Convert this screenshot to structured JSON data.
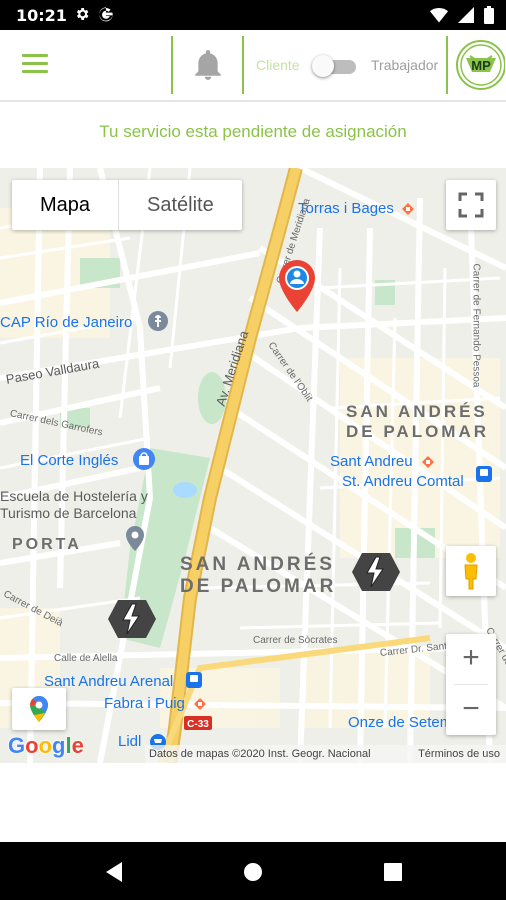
{
  "status_bar": {
    "time": "10:21"
  },
  "header": {
    "role_left": "Cliente",
    "role_right": "Trabajador",
    "logo_text": "MP"
  },
  "pending_message": "Tu servicio esta pendiente de asignación",
  "map": {
    "type_buttons": {
      "map": "Mapa",
      "satellite": "Satélite"
    },
    "zoom_in": "+",
    "zoom_out": "−",
    "google_logo": "Google",
    "attribution": "Datos de mapas ©2020 Inst. Geogr. Nacional",
    "terms": "Términos de uso",
    "labels": {
      "torras": "Torras i Bages",
      "cap": "CAP Río de Janeiro",
      "paseo": "Paseo Valldaura",
      "sa_big1": "SAN ANDRÉS",
      "sa_big1b": "DE PALOMAR",
      "sant_andreu": "Sant Andreu",
      "st_andreu_comtal": "St. Andreu Comtal",
      "corte": "El Corte Inglés",
      "escuela1": "Escuela de Hostelería y",
      "escuela2": "Turismo de Barcelona",
      "porta": "PORTA",
      "sa_big2": "SAN ANDRÉS",
      "sa_big2b": "DE PALOMAR",
      "meridiana": "Av. Meridiana",
      "carrer_meridiana": "Carrer de Meridiana",
      "carrer_garrofers": "Carrer dels Garrofers",
      "carrer_oblit": "Carrer de l'Oblit",
      "carrer_fernando": "Carrer de Fernando Pessoa",
      "carrer_socrates": "Carrer de Sòcrates",
      "carrer_dr": "Carrer Dr. Sant",
      "calle_alella": "Calle de Alella",
      "carrer_deia": "Carrer de Deià",
      "sa_arenal": "Sant Andreu Arenal",
      "fabra": "Fabra i Puig",
      "c33": "C-33",
      "lidl": "Lidl",
      "onze": "Onze de Setem",
      "carrer_c": "Carrer de"
    }
  },
  "colors": {
    "accent": "#8bc34a",
    "map_bg": "#efefe9",
    "avenue": "#f6cf65",
    "green_area": "#c8e6c9",
    "marker": "#ea4335"
  }
}
